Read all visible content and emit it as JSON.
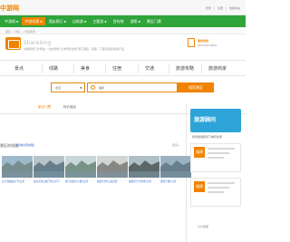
{
  "topbar": {
    "logo": "中游网",
    "links": [
      "登录",
      "|",
      "注册",
      "|",
      "收藏本站"
    ]
  },
  "nav": {
    "items": [
      {
        "label": "中游网",
        "caret": "▼",
        "active": false
      },
      {
        "label": "中游机票",
        "caret": "▼",
        "active": true
      },
      {
        "label": "酒店预订",
        "caret": "▼",
        "active": false
      },
      {
        "label": "自助游",
        "caret": "▼",
        "active": false
      },
      {
        "label": "主题游",
        "caret": "▼",
        "active": false
      },
      {
        "label": "目的地",
        "caret": "",
        "active": false
      },
      {
        "label": "游帆",
        "caret": "▼",
        "active": false
      },
      {
        "label": "景区门票",
        "caret": "",
        "active": false
      }
    ]
  },
  "breadcrumb": [
    "首页",
    ">",
    "景区",
    ">",
    "景区搜索"
  ],
  "header": {
    "title": "Sharelong",
    "desc": "中国旅游门户网站  一站式服务  让你轻松出游  预订酒店、机票、门票及更多旅游产品",
    "hotline_label": "服务热线",
    "hotline_number": "400-000-0000"
  },
  "tabs": [
    "景点",
    "线路",
    "美食",
    "住宿",
    "交通",
    "旅游攻略",
    "旅游商家"
  ],
  "search": {
    "province": "北京",
    "caret": "▼",
    "keyword": "福建",
    "button": "搜索景区"
  },
  "filter": {
    "active": "景点门票",
    "other": "特价酒店"
  },
  "section": {
    "title": "景区的线路",
    "link": "[查看全部线路]",
    "more": "更多>"
  },
  "thumbs": [
    {
      "caption": "北京到福建双飞5日游",
      "sky": "#9fb9cc",
      "ground": "#6a7f7a"
    },
    {
      "caption": "福州武夷山厦门纯玩双飞",
      "sky": "#b7c3c8",
      "ground": "#4a6a78"
    },
    {
      "caption": "厦门鼓浪屿土楼4日游",
      "sky": "#c9d6da",
      "ground": "#5d7b69"
    },
    {
      "caption": "福建全景8日深度游",
      "sky": "#d2d6d5",
      "ground": "#6e6e68"
    },
    {
      "caption": "福建泰宁大金湖3日游",
      "sky": "#aebfc5",
      "ground": "#3e4a46"
    },
    {
      "caption": "闽西土楼2日游",
      "sky": "#9cb2c2",
      "ground": "#556d7a"
    }
  ],
  "sidebar": {
    "head": "旅游顾问",
    "sub": "找到旅游顾问下单有优惠",
    "cards": [
      {
        "icon": "福建",
        "lines": 3
      },
      {
        "icon": "福建",
        "lines": 3
      }
    ],
    "foot": "今日客服"
  },
  "colors": {
    "accent": "#f08300",
    "nav": "#2ea43a",
    "link": "#3a6ec9",
    "sidebar_head": "#2ea3d8"
  }
}
